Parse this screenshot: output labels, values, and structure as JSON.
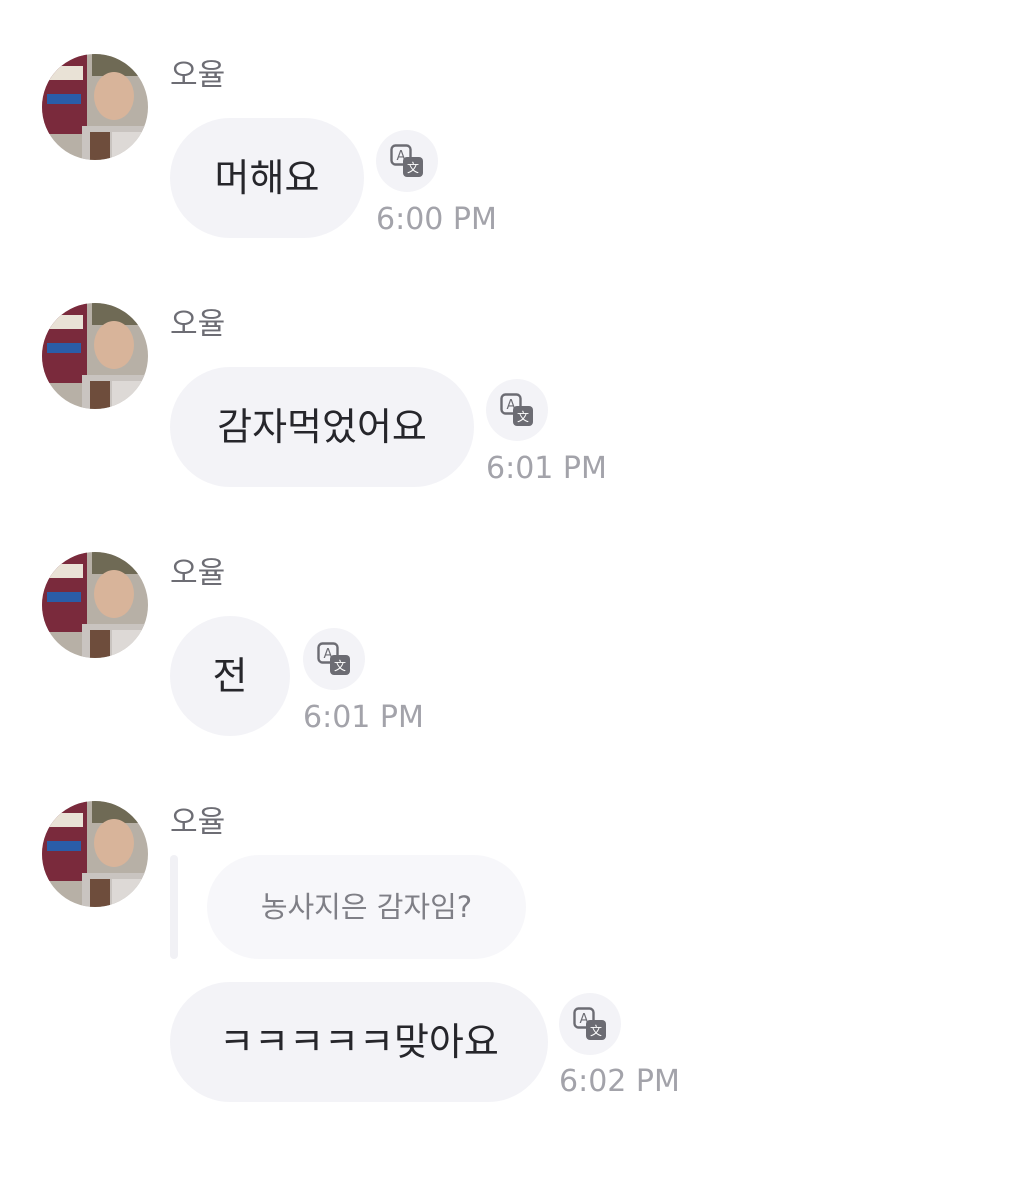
{
  "messages": [
    {
      "sender": "오율",
      "text": "머해요",
      "time": "6:00 PM",
      "avatar_icon": "profile-photo",
      "translate_icon": "translate-icon"
    },
    {
      "sender": "오율",
      "text": "감자먹었어요",
      "time": "6:01 PM",
      "avatar_icon": "profile-photo",
      "translate_icon": "translate-icon"
    },
    {
      "sender": "오율",
      "text": "전",
      "time": "6:01 PM",
      "avatar_icon": "profile-photo",
      "translate_icon": "translate-icon"
    },
    {
      "sender": "오율",
      "reply_to": "농사지은 감자임?",
      "text": "ㅋㅋㅋㅋㅋ맞아요",
      "time": "6:02 PM",
      "avatar_icon": "profile-photo",
      "translate_icon": "translate-icon"
    }
  ],
  "colors": {
    "bubble": "#f3f3f7",
    "message_text": "#26262b",
    "sender_text": "#6d6d74",
    "time_text": "#a3a3aa"
  }
}
